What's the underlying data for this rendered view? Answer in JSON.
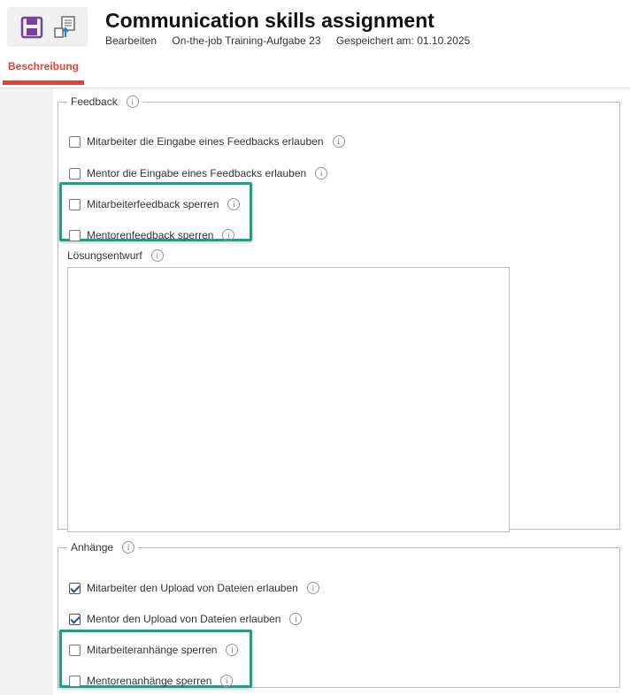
{
  "header": {
    "title": "Communication skills assignment",
    "meta": {
      "mode": "Bearbeiten",
      "task": "On-the-job Training-Aufgabe 23",
      "saved": "Gespeichert am: 01.10.2025"
    }
  },
  "toolbar": {
    "save_icon": "save-icon",
    "publish_icon": "publish-icon"
  },
  "tabs": [
    {
      "label": "Beschreibung",
      "active": true
    }
  ],
  "feedback": {
    "legend": "Feedback",
    "options": [
      {
        "label": "Mitarbeiter die Eingabe eines Feedbacks erlauben",
        "checked": false
      },
      {
        "label": "Mentor die Eingabe eines Feedbacks erlauben",
        "checked": false
      },
      {
        "label": "Mitarbeiterfeedback sperren",
        "checked": false
      },
      {
        "label": "Mentorenfeedback sperren",
        "checked": false
      }
    ],
    "solution_label": "Lösungsentwurf",
    "solution_value": ""
  },
  "attachments": {
    "legend": "Anhänge",
    "options": [
      {
        "label": "Mitarbeiter den Upload von Dateien erlauben",
        "checked": true
      },
      {
        "label": "Mentor den Upload von Dateien erlauben",
        "checked": true
      },
      {
        "label": "Mitarbeiteranhänge sperren",
        "checked": false
      },
      {
        "label": "Mentorenanhänge sperren",
        "checked": false
      }
    ]
  },
  "colors": {
    "accent": "#e34234",
    "highlight": "#1aa086",
    "save_icon": "#7b3fa0"
  },
  "info_glyph": "i"
}
